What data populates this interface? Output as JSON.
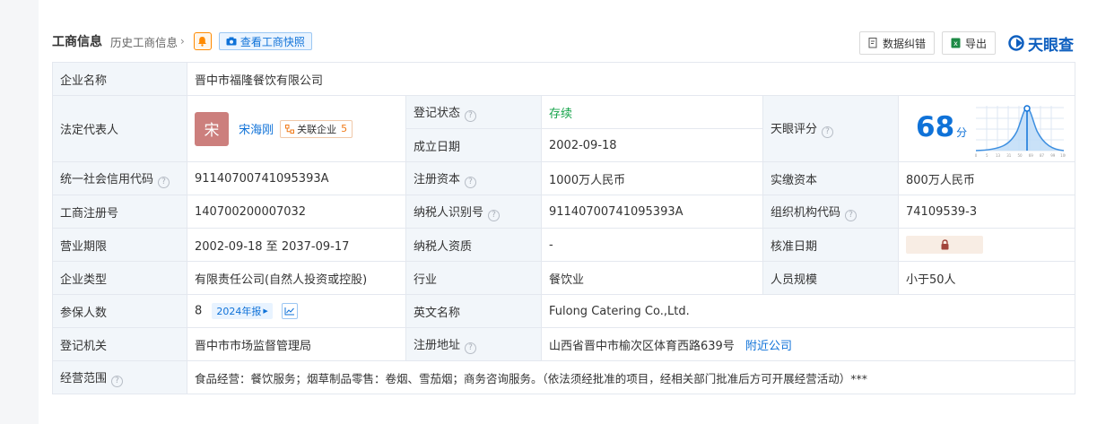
{
  "header": {
    "title": "工商信息",
    "history_link": "历史工商信息",
    "snapshot_button": "查看工商快照",
    "correct_button": "数据纠错",
    "export_button": "导出",
    "brand": "天眼查"
  },
  "colors": {
    "accent": "#0f72d8",
    "label_bg": "#f2f6fa",
    "status_green": "#15a34a",
    "bell_orange": "#ff8a00"
  },
  "company": {
    "name_label": "企业名称",
    "name": "晋中市福隆餐饮有限公司",
    "legal_rep_label": "法定代表人",
    "avatar_char": "宋",
    "legal_rep": "宋海刚",
    "related_label": "关联企业",
    "related_count": "5",
    "reg_status_label": "登记状态",
    "reg_status": "存续",
    "founded_label": "成立日期",
    "founded": "2002-09-18",
    "score_label": "天眼评分",
    "score": "68",
    "score_unit": "分",
    "credit_code_label": "统一社会信用代码",
    "credit_code": "91140700741095393A",
    "reg_capital_label": "注册资本",
    "reg_capital": "1000万人民币",
    "paid_capital_label": "实缴资本",
    "paid_capital": "800万人民币",
    "biz_reg_no_label": "工商注册号",
    "biz_reg_no": "140700200007032",
    "tax_id_label": "纳税人识别号",
    "tax_id": "91140700741095393A",
    "org_code_label": "组织机构代码",
    "org_code": "74109539-3",
    "term_label": "营业期限",
    "term": "2002-09-18 至 2037-09-17",
    "taxpayer_qual_label": "纳税人资质",
    "taxpayer_qual": "-",
    "approval_date_label": "核准日期",
    "type_label": "企业类型",
    "type": "有限责任公司(自然人投资或控股)",
    "industry_label": "行业",
    "industry": "餐饮业",
    "staff_size_label": "人员规模",
    "staff_size": "小于50人",
    "insured_label": "参保人数",
    "insured": "8",
    "report_tag": "2024年报",
    "english_name_label": "英文名称",
    "english_name": "Fulong Catering Co.,Ltd.",
    "authority_label": "登记机关",
    "authority": "晋中市市场监督管理局",
    "address_label": "注册地址",
    "address": "山西省晋中市榆次区体育西路639号",
    "nearby_link": "附近公司",
    "scope_label": "经营范围",
    "scope": "食品经营：餐饮服务；烟草制品零售：卷烟、雪茄烟；商务咨询服务。（依法须经批准的项目，经相关部门批准后方可开展经营活动）***"
  },
  "score_curve_ticks": [
    "0",
    "5",
    "13",
    "31",
    "50",
    "69",
    "87",
    "99",
    "100"
  ]
}
